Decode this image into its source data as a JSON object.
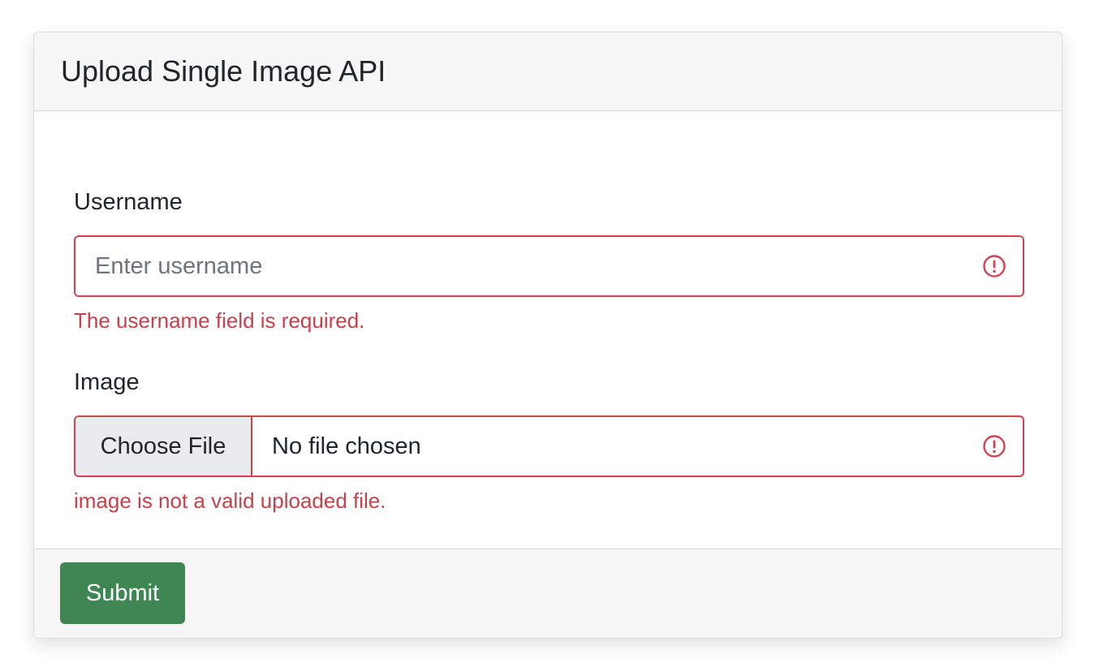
{
  "card": {
    "title": "Upload Single Image API"
  },
  "form": {
    "username": {
      "label": "Username",
      "value": "",
      "placeholder": "Enter username",
      "error": "The username field is required."
    },
    "image": {
      "label": "Image",
      "button_label": "Choose File",
      "file_status": "No file chosen",
      "error": "image is not a valid uploaded file."
    },
    "submit_label": "Submit"
  },
  "icons": {
    "invalid": "exclamation-circle-icon"
  },
  "colors": {
    "invalid": "#d1434f",
    "submit": "#3e8753",
    "header_bg": "#f7f7f7",
    "file_button_bg": "#e9ecef"
  }
}
